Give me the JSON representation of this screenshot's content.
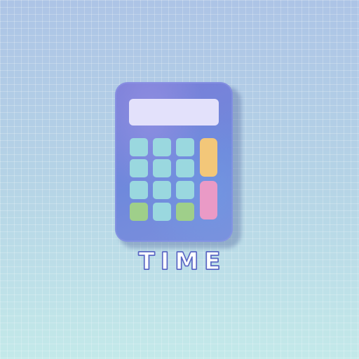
{
  "app": {
    "label": "TIME",
    "icon": "calculator-icon"
  },
  "colors": {
    "body": "#7b7fd8",
    "screen": "#e3e1fb",
    "key_teal": "#9ad8df",
    "key_green": "#9fcf8a",
    "key_orange": "#f3c779",
    "key_pink": "#ea9ac6",
    "label_outline": "#5b68c4"
  }
}
